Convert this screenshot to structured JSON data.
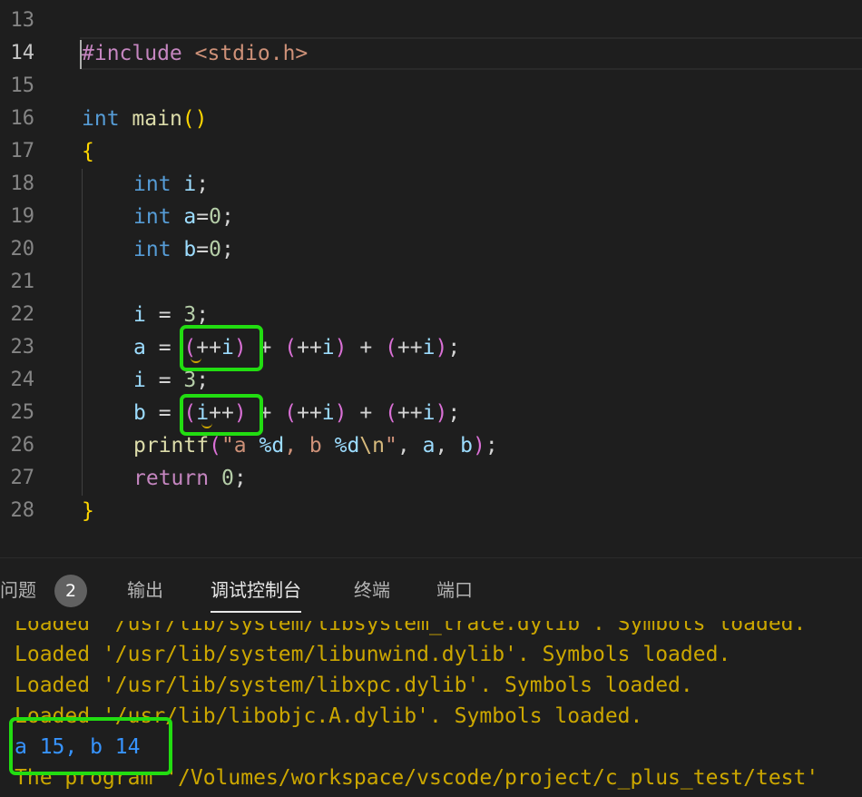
{
  "editor": {
    "lines": [
      {
        "num": "13",
        "code": ""
      },
      {
        "num": "14",
        "code": "#include <stdio.h>"
      },
      {
        "num": "15",
        "code": ""
      },
      {
        "num": "16",
        "code": "int main()"
      },
      {
        "num": "17",
        "code": "{"
      },
      {
        "num": "18",
        "code": "int i;"
      },
      {
        "num": "19",
        "code": "int a=0;"
      },
      {
        "num": "20",
        "code": "int b=0;"
      },
      {
        "num": "21",
        "code": ""
      },
      {
        "num": "22",
        "code": "i = 3;"
      },
      {
        "num": "23",
        "code": "a = (++i) + (++i) + (++i);"
      },
      {
        "num": "24",
        "code": "i = 3;"
      },
      {
        "num": "25",
        "code": "b = (i++) + (++i) + (++i);"
      },
      {
        "num": "26",
        "code": "printf(\"a %d, b %d\\n\", a, b);"
      },
      {
        "num": "27",
        "code": "return 0;"
      },
      {
        "num": "28",
        "code": "}"
      }
    ]
  },
  "panel": {
    "tabs": [
      {
        "label": "问题"
      },
      {
        "label": "输出"
      },
      {
        "label": "调试控制台"
      },
      {
        "label": "终端"
      },
      {
        "label": "端口"
      }
    ],
    "problems_count": "2",
    "active_tab": "调试控制台"
  },
  "console": {
    "lines": [
      "Loaded '/usr/lib/system/libsystem_trace.dylib'. Symbols loaded.",
      "Loaded '/usr/lib/system/libunwind.dylib'. Symbols loaded.",
      "Loaded '/usr/lib/system/libxpc.dylib'. Symbols loaded.",
      "Loaded '/usr/lib/libobjc.A.dylib'. Symbols loaded.",
      "a 15, b 14",
      "The program '/Volumes/workspace/vscode/project/c_plus_test/test'"
    ]
  },
  "colors": {
    "highlight_box": "#22dd11",
    "console_text": "#cca700",
    "program_output": "#3794ff"
  }
}
